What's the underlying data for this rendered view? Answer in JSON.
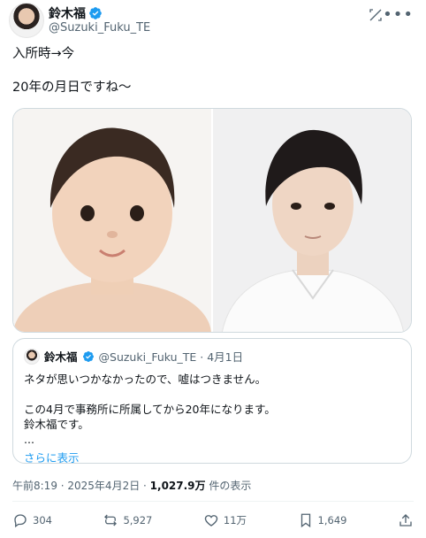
{
  "author": {
    "display_name": "鈴木福",
    "handle": "@Suzuki_Fuku_TE"
  },
  "tweet": {
    "text": "入所時→今\n\n20年の月日ですね〜"
  },
  "quote": {
    "display_name": "鈴木福",
    "meta": "@Suzuki_Fuku_TE · 4月1日",
    "body": "ネタが思いつかなかったので、嘘はつきません。\n\nこの4月で事務所に所属してから20年になります。\n鈴木福です。\n...",
    "show_more": "さらに表示"
  },
  "post_meta": {
    "time_date": "午前8:19 · 2025年4月2日 · ",
    "views_count": "1,027.9万",
    "views_label": " 件の表示"
  },
  "actions": {
    "replies": "304",
    "reposts": "5,927",
    "likes": "11万",
    "bookmarks": "1,649"
  },
  "colors": {
    "accent": "#1d9bf0",
    "muted": "#536471",
    "border": "#cfd9de"
  }
}
